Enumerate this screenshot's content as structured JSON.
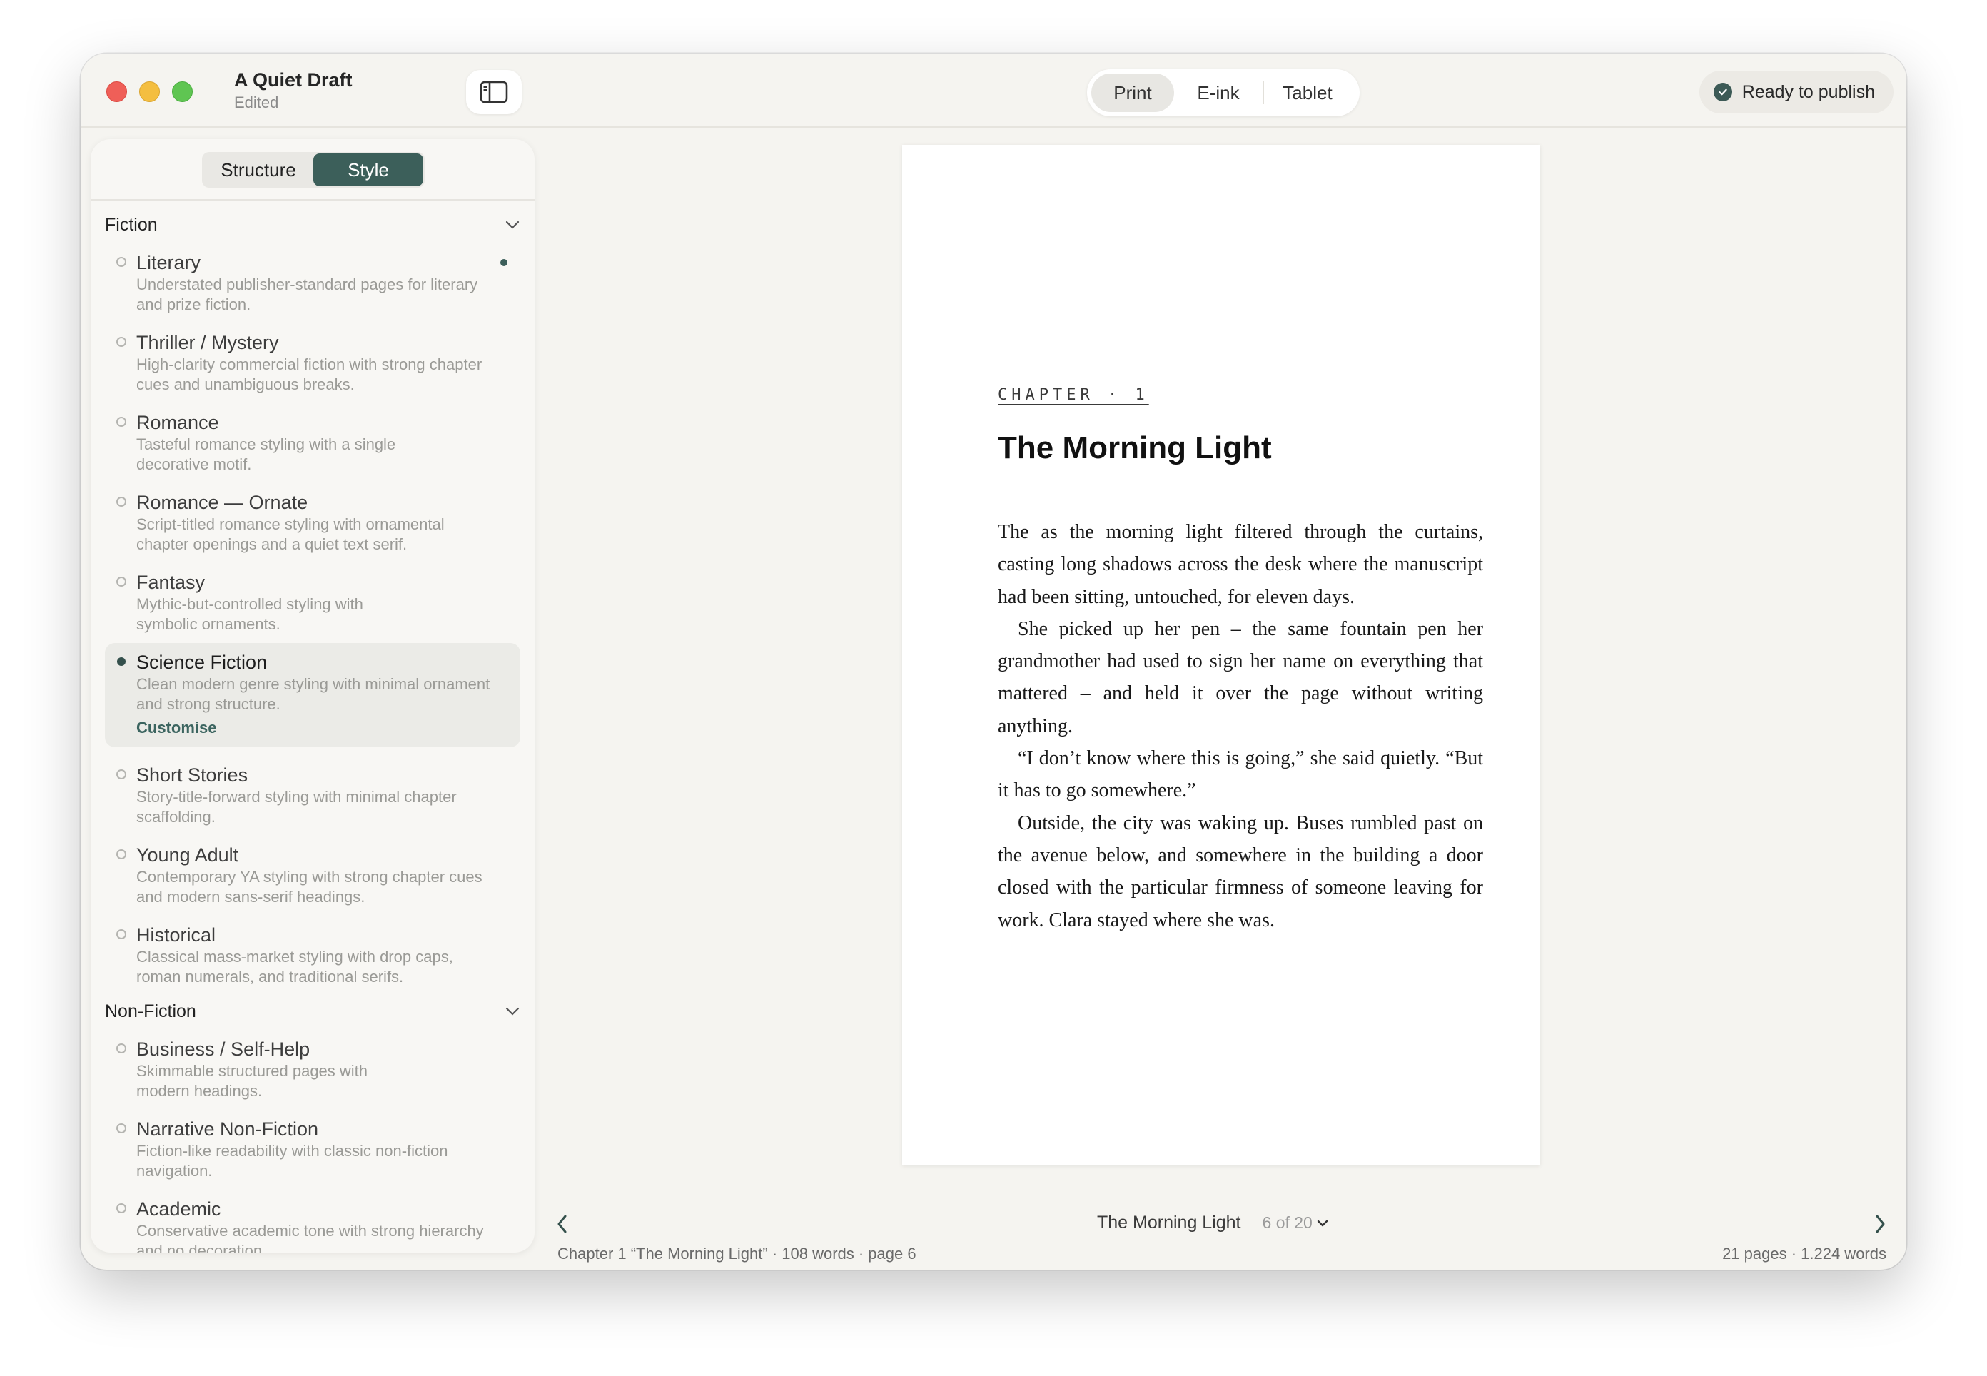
{
  "window": {
    "doc_title": "A Quiet Draft",
    "doc_status": "Edited"
  },
  "toolbar": {
    "devices": [
      "Print",
      "E-ink",
      "Tablet"
    ],
    "active_device": "Print",
    "publish_label": "Ready to publish"
  },
  "sidebar": {
    "tabs": {
      "structure": "Structure",
      "style": "Style"
    },
    "active_tab": "Style",
    "sections": [
      {
        "label": "Fiction",
        "items": [
          {
            "title": "Literary",
            "desc": "Understated publisher-standard pages for literary and prize fiction."
          },
          {
            "title": "Thriller / Mystery",
            "desc": "High-clarity commercial fiction with strong chapter cues and unambiguous breaks."
          },
          {
            "title": "Romance",
            "desc": "Tasteful romance styling with a single decorative motif."
          },
          {
            "title": "Romance — Ornate",
            "desc": "Script-titled romance styling with ornamental chapter openings and a quiet text serif."
          },
          {
            "title": "Fantasy",
            "desc": "Mythic-but-controlled styling with symbolic ornaments."
          },
          {
            "title": "Science Fiction",
            "desc": "Clean modern genre styling with minimal ornament and strong structure.",
            "link": "Customise"
          },
          {
            "title": "Short Stories",
            "desc": "Story-title-forward styling with minimal chapter scaffolding."
          },
          {
            "title": "Young Adult",
            "desc": "Contemporary YA styling with strong chapter cues and modern sans-serif headings."
          },
          {
            "title": "Historical",
            "desc": "Classical mass-market styling with drop caps, roman numerals, and traditional serifs."
          }
        ]
      },
      {
        "label": "Non-Fiction",
        "items": [
          {
            "title": "Business / Self-Help",
            "desc": "Skimmable structured pages with modern headings."
          },
          {
            "title": "Narrative Non-Fiction",
            "desc": "Fiction-like readability with classic non-fiction navigation."
          },
          {
            "title": "Academic",
            "desc": "Conservative academic tone with strong hierarchy and no decoration."
          }
        ]
      }
    ]
  },
  "preview": {
    "chapter_label": "CHAPTER · 1",
    "chapter_title": "The Morning Light",
    "paragraphs": [
      "The as the morning light filtered through the curtains, casting long shadows across the desk where the manuscript had been sitting, untouched, for eleven days.",
      "She picked up her pen – the same fountain pen her grandmother had used to sign her name on everything that mattered – and held it over the page without writing anything.",
      "“I don’t know where this is going,” she said quietly. “But it has to go somewhere.”",
      "Outside, the city was waking up. Buses rumbled past on the avenue below, and somewhere in the building a door closed with the particular firmness of someone leaving for work. Clara stayed where she was."
    ]
  },
  "navigator": {
    "chapter": "The Morning Light",
    "page_indicator": "6 of 20"
  },
  "status": {
    "left": "Chapter 1 “The Morning Light”  ·  108 words  ·  page 6",
    "right": "21 pages  ·  1.224 words"
  },
  "colors": {
    "accent": "#3c5f5a",
    "window_bg": "#f5f4f0",
    "traffic_red": "#ef5f58",
    "traffic_yellow": "#f4be40",
    "traffic_green": "#5fc552"
  },
  "icons": {
    "sidebar_toggle": "sidebar-icon",
    "publish": "check-circle-icon",
    "collapse": "chevron-down-icon",
    "prev": "chevron-left-icon",
    "next": "chevron-right-icon"
  }
}
